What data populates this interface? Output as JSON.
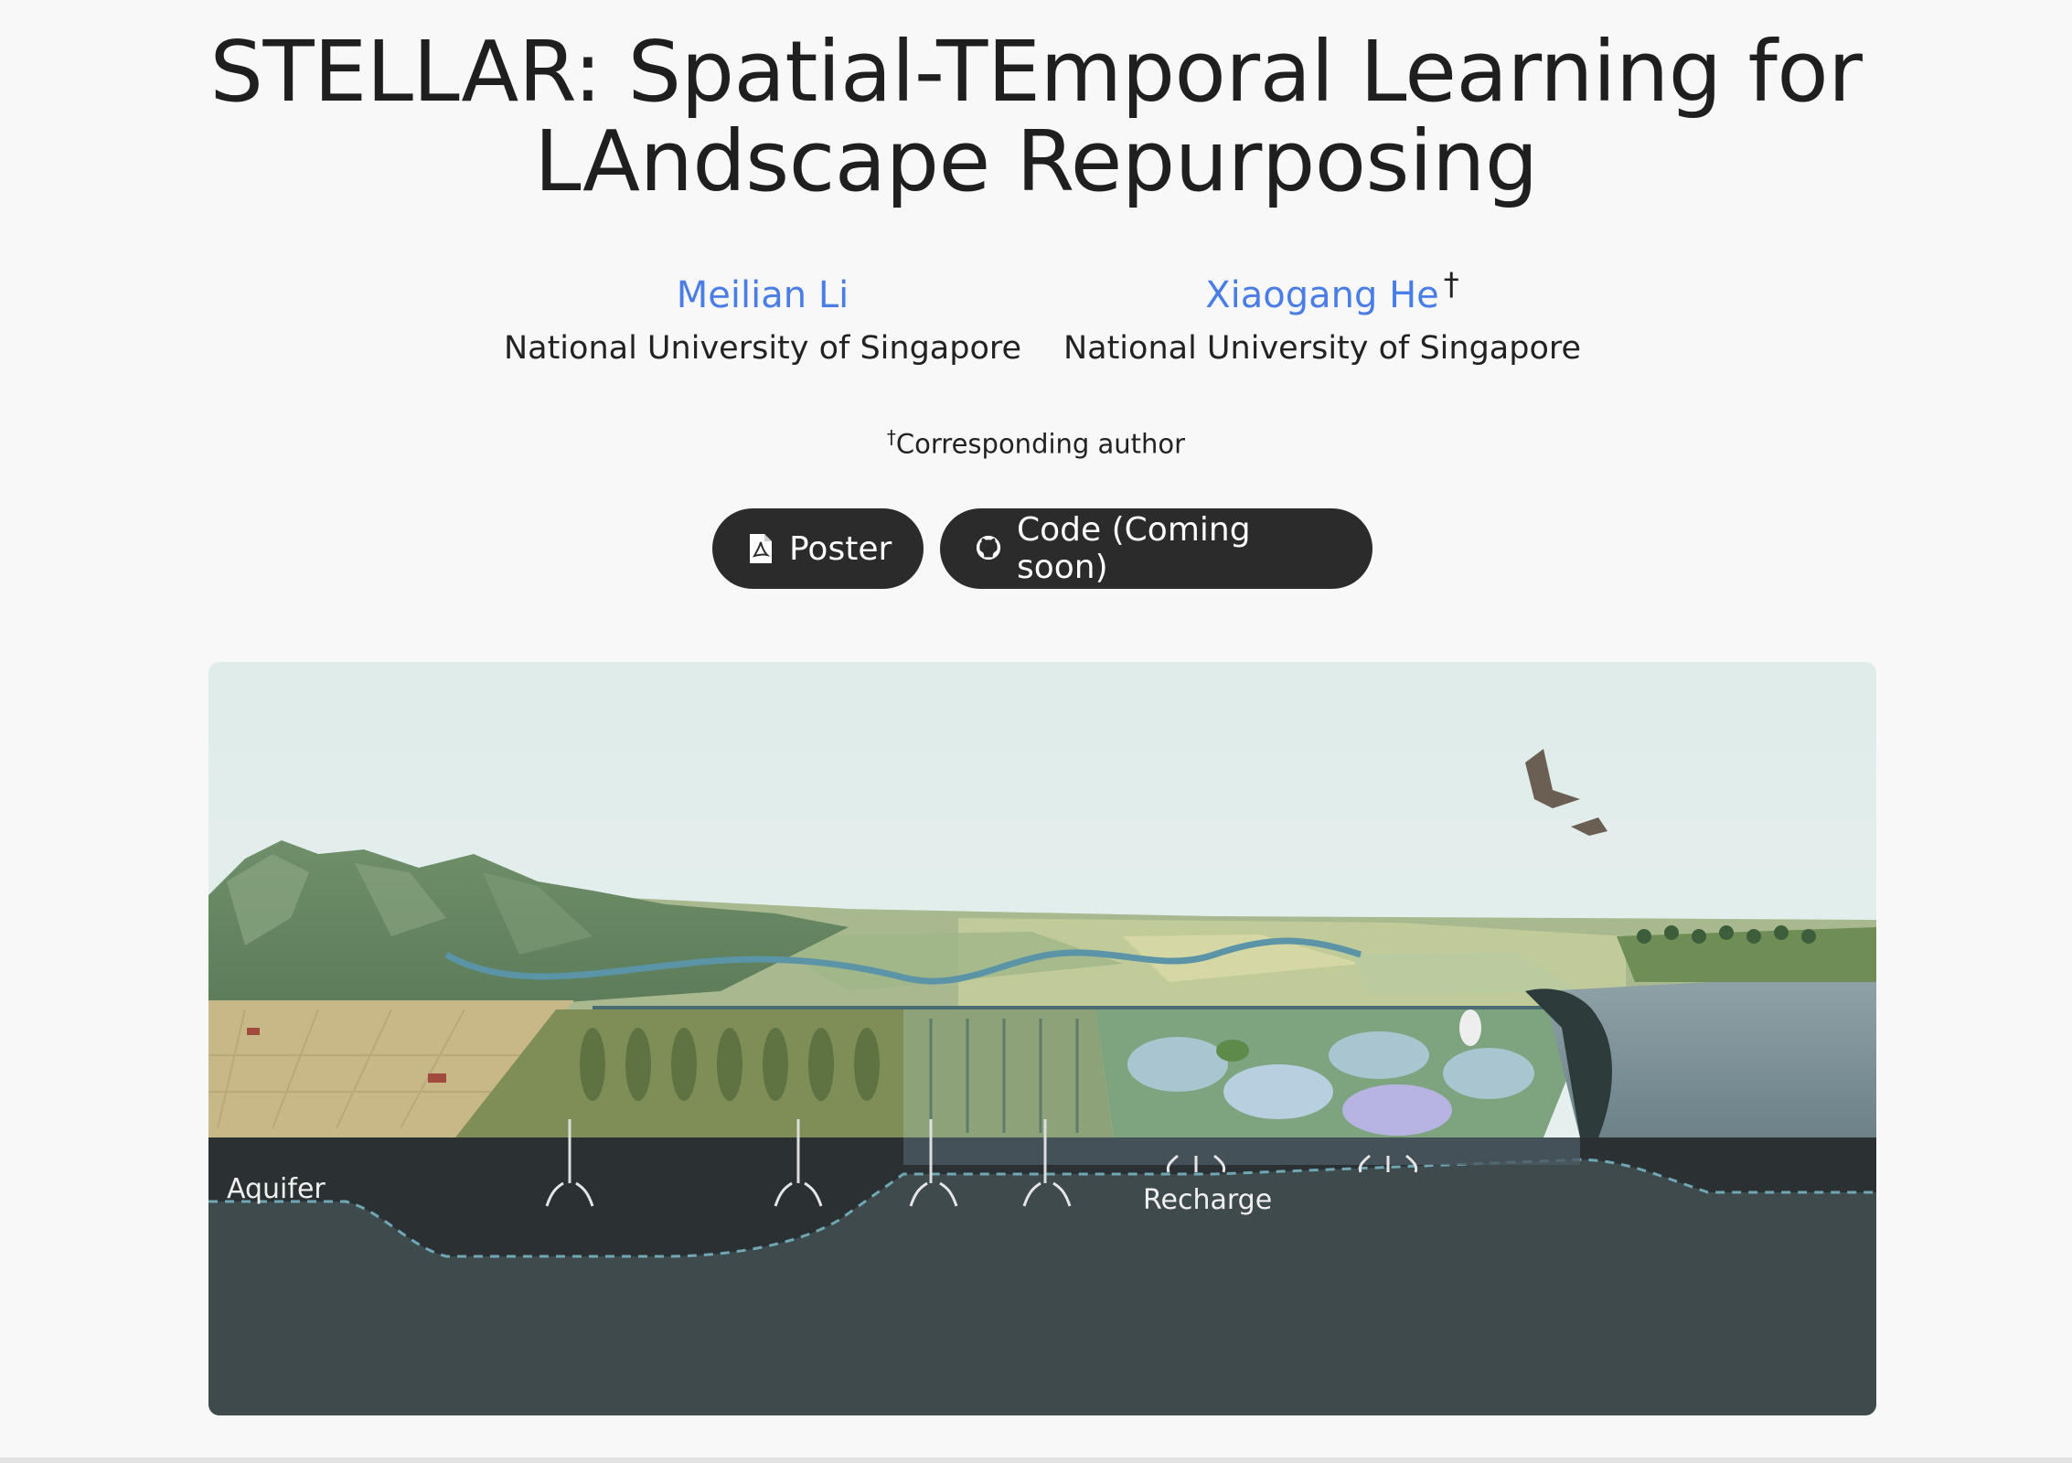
{
  "title": {
    "line1": "STELLAR: Spatial-TEmporal Learning for",
    "line2": "LAndscape Repurposing"
  },
  "authors": [
    {
      "name": "Meilian Li",
      "affiliation": "National University of Singapore",
      "dagger": ""
    },
    {
      "name": "Xiaogang He",
      "affiliation": "National University of Singapore",
      "dagger": "†"
    }
  ],
  "note": {
    "mark": "†",
    "text": "Corresponding author"
  },
  "buttons": {
    "poster": {
      "label": "Poster",
      "icon": "file-pdf-icon"
    },
    "code": {
      "label": "Code (Coming soon)",
      "icon": "github-icon"
    }
  },
  "figure": {
    "labels": {
      "aquifer": "Aquifer",
      "recharge": "Recharge"
    }
  }
}
